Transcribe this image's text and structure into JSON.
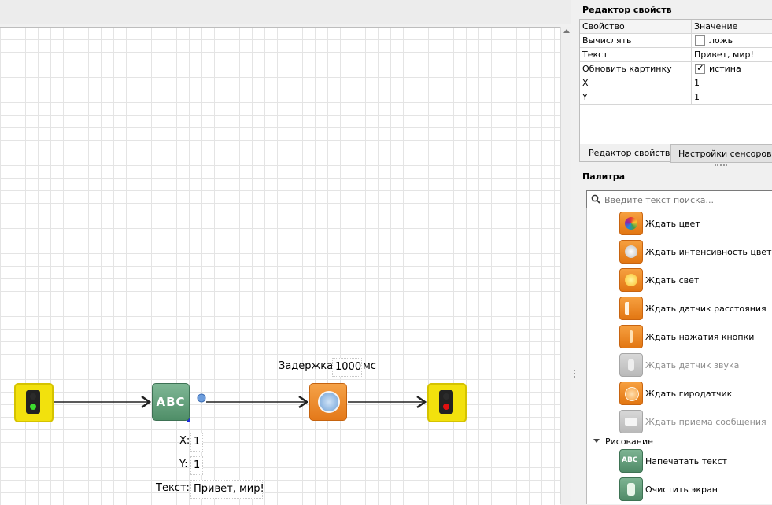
{
  "property_editor": {
    "title": "Редактор свойств",
    "columns": [
      "Свойство",
      "Значение"
    ],
    "rows": [
      {
        "name": "Вычислять",
        "value": "ложь",
        "checkbox": true,
        "checked": false
      },
      {
        "name": "Текст",
        "value": "Привет, мир!"
      },
      {
        "name": "Обновить картинку",
        "value": "истина",
        "checkbox": true,
        "checked": true
      },
      {
        "name": "X",
        "value": "1"
      },
      {
        "name": "Y",
        "value": "1"
      }
    ],
    "tabs": [
      "Редактор свойств",
      "Настройки сенсоров"
    ],
    "active_tab": "Настройки сенсоров"
  },
  "palette": {
    "title": "Палитра",
    "search_placeholder": "Введите текст поиска...",
    "items": [
      {
        "label": "Ждать цвет",
        "icon": "color-wheel-icon",
        "enabled": true
      },
      {
        "label": "Ждать интенсивность цвета",
        "icon": "color-intensity-icon",
        "enabled": true
      },
      {
        "label": "Ждать свет",
        "icon": "light-sensor-icon",
        "enabled": true
      },
      {
        "label": "Ждать датчик расстояния",
        "icon": "distance-sensor-icon",
        "enabled": true
      },
      {
        "label": "Ждать нажатия кнопки",
        "icon": "button-press-icon",
        "enabled": true
      },
      {
        "label": "Ждать датчик звука",
        "icon": "microphone-icon",
        "enabled": false
      },
      {
        "label": "Ждать гиродатчик",
        "icon": "gyro-sensor-icon",
        "enabled": true
      },
      {
        "label": "Ждать приема сообщения",
        "icon": "message-icon",
        "enabled": false
      }
    ],
    "section": {
      "label": "Рисование",
      "expanded": true
    },
    "section_items": [
      {
        "label": "Напечатать текст",
        "icon": "abc-icon"
      },
      {
        "label": "Очистить экран",
        "icon": "eraser-icon"
      }
    ]
  },
  "diagram": {
    "abc_block_text": "ABC",
    "delay": {
      "label": "Задержка:",
      "value": "1000",
      "unit": "мс"
    },
    "print_params": {
      "x_label": "X:",
      "x_value": "1",
      "y_label": "Y:",
      "y_value": "1",
      "text_label": "Текст:",
      "text_value": "Привет, мир!"
    }
  },
  "colors": {
    "start_lamp": "#3ddc2f",
    "stop_lamp": "#e01010",
    "block_orange": "#e98a26",
    "block_green": "#5e9b76",
    "signal_yellow": "#f2e10d"
  }
}
